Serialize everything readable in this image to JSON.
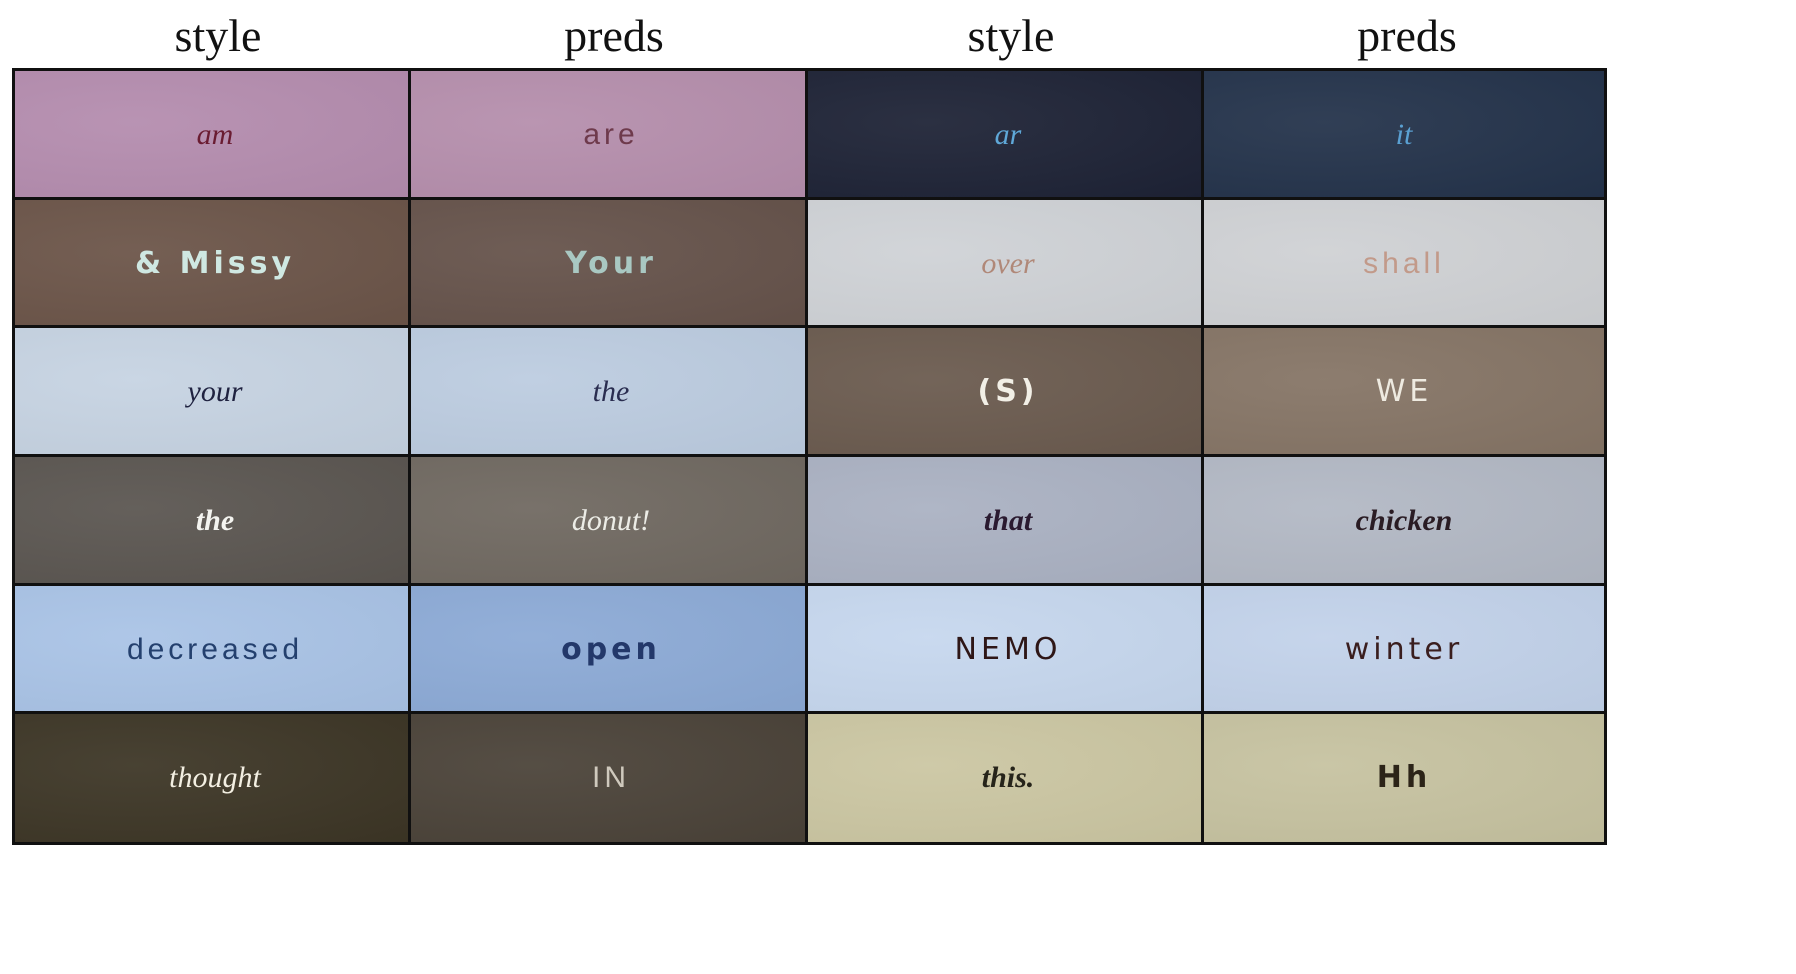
{
  "headers": [
    "style",
    "preds",
    "style",
    "preds"
  ],
  "tiles": [
    [
      {
        "text": "am",
        "bg": "#b48cae",
        "ink": "#6a1c32",
        "cls": "script"
      },
      {
        "text": "are",
        "bg": "#b58eac",
        "ink": "#6e3a4c",
        "cls": "print thin"
      },
      {
        "text": "ar",
        "bg": "#1d2235",
        "ink": "#5fa8d8",
        "cls": "script"
      },
      {
        "text": "it",
        "bg": "#23324a",
        "ink": "#5aa0d2",
        "cls": "script"
      }
    ],
    [
      {
        "text": "& Missy",
        "bg": "#6b5448",
        "ink": "#cfe8e2",
        "cls": "print bold"
      },
      {
        "text": "Your",
        "bg": "#65524a",
        "ink": "#a9c8c2",
        "cls": "print bold"
      },
      {
        "text": "over",
        "bg": "#cfd2d6",
        "ink": "#b08878",
        "cls": "script"
      },
      {
        "text": "shall",
        "bg": "#cfd1d4",
        "ink": "#c29a8a",
        "cls": "print thin"
      }
    ],
    [
      {
        "text": "your",
        "bg": "#c6d3e2",
        "ink": "#1f2240",
        "cls": "script"
      },
      {
        "text": "the",
        "bg": "#bccce0",
        "ink": "#2a2d50",
        "cls": "script"
      },
      {
        "text": "(S)",
        "bg": "#6a5a4e",
        "ink": "#f2efe6",
        "cls": "print bold"
      },
      {
        "text": "WE",
        "bg": "#857465",
        "ink": "#eeeae0",
        "cls": "print"
      }
    ],
    [
      {
        "text": "the",
        "bg": "#5a5550",
        "ink": "#f4f4f0",
        "cls": "script bold"
      },
      {
        "text": "donut!",
        "bg": "#6f6860",
        "ink": "#ecece6",
        "cls": "script"
      },
      {
        "text": "that",
        "bg": "#aab1c2",
        "ink": "#2a1a30",
        "cls": "script bold"
      },
      {
        "text": "chicken",
        "bg": "#b2b8c4",
        "ink": "#2a1c24",
        "cls": "script bold"
      }
    ],
    [
      {
        "text": "decreased",
        "bg": "#a9c3e6",
        "ink": "#24406e",
        "cls": "print thin"
      },
      {
        "text": "open",
        "bg": "#8caad6",
        "ink": "#23386a",
        "cls": "print bold"
      },
      {
        "text": "NEMO",
        "bg": "#c6d7ee",
        "ink": "#2e1616",
        "cls": "print"
      },
      {
        "text": "winter",
        "bg": "#c2d2ea",
        "ink": "#3a1e1e",
        "cls": "print"
      }
    ],
    [
      {
        "text": "thought",
        "bg": "#3c3525",
        "ink": "#f3efe2",
        "cls": "script"
      },
      {
        "text": "IN",
        "bg": "#4a4238",
        "ink": "#cfc9bd",
        "cls": "print thin"
      },
      {
        "text": "this.",
        "bg": "#cbc6a2",
        "ink": "#26241a",
        "cls": "script bold"
      },
      {
        "text": "Hh",
        "bg": "#c6c2a0",
        "ink": "#2c2418",
        "cls": "print bold"
      }
    ]
  ]
}
